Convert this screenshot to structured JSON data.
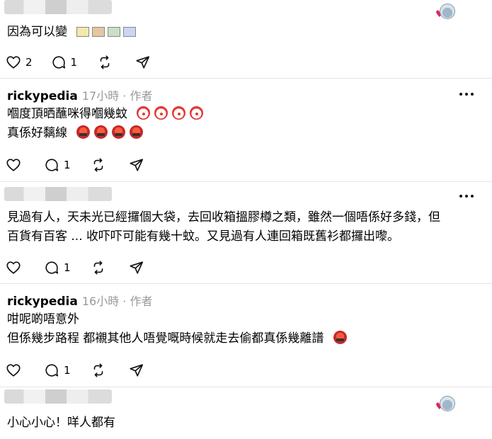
{
  "posts": [
    {
      "body_lines": [
        "因為可以變"
      ],
      "likes": "2",
      "replies": "1"
    },
    {
      "author": "rickypedia",
      "meta": "17小時 · 作者",
      "body_lines": [
        "嗰度頂晒蘸咪得嗰幾蚊",
        "真係好黐線"
      ],
      "replies": "1"
    },
    {
      "body_lines": [
        "見過有人，天未光已經攞個大袋，去回收箱搵膠樽之類，雖然一個唔係好多錢，但",
        "百貨有百客 ... 收吓吓可能有幾十蚊。又見過有人連回箱既舊衫都攞出嚟。"
      ],
      "replies": "1"
    },
    {
      "author": "rickypedia",
      "meta": "16小時 · 作者",
      "body_lines": [
        "咁呢啲唔意外",
        "但係幾步路程 都襯其他人唔覺嘅時候就走去偷都真係幾離譜"
      ],
      "replies": "1"
    },
    {
      "body_lines": [
        "小心小心！咩人都有"
      ]
    }
  ],
  "icons": {
    "like": "heart-outline-icon",
    "reply": "comment-bubble-icon",
    "repost": "repost-arrows-icon",
    "share": "send-plane-icon",
    "more": "more-dots-icon"
  }
}
